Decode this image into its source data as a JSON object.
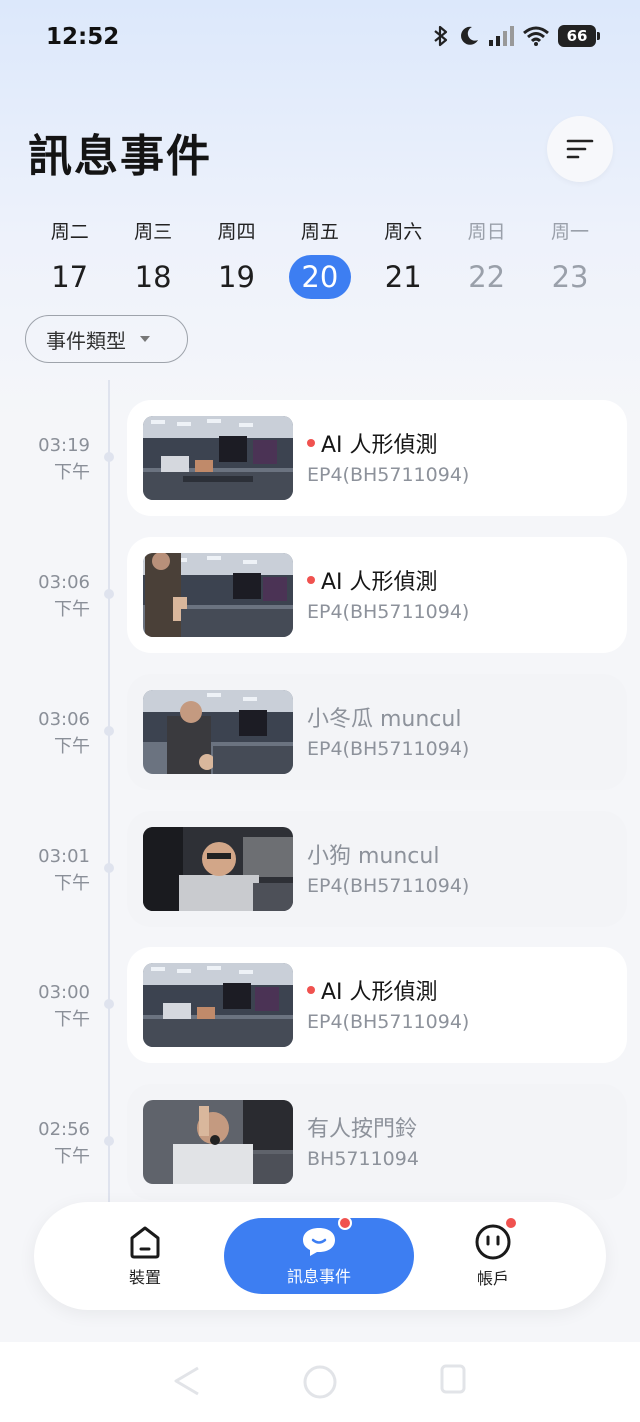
{
  "status_bar": {
    "time": "12:52",
    "battery": "66"
  },
  "header": {
    "title": "訊息事件"
  },
  "week": [
    {
      "name": "周二",
      "num": "17"
    },
    {
      "name": "周三",
      "num": "18"
    },
    {
      "name": "周四",
      "num": "19"
    },
    {
      "name": "周五",
      "num": "20",
      "selected": true
    },
    {
      "name": "周六",
      "num": "21"
    },
    {
      "name": "周日",
      "num": "22",
      "future": true
    },
    {
      "name": "周一",
      "num": "23",
      "future": true
    }
  ],
  "filter": {
    "label": "事件類型"
  },
  "events": [
    {
      "time": "03:19",
      "period": "下午",
      "title": "AI 人形偵測",
      "device": "EP4(BH5711094)",
      "unread": true
    },
    {
      "time": "03:06",
      "period": "下午",
      "title": "AI 人形偵測",
      "device": "EP4(BH5711094)",
      "unread": true
    },
    {
      "time": "03:06",
      "period": "下午",
      "title": "小冬瓜 muncul",
      "device": "EP4(BH5711094)",
      "unread": false
    },
    {
      "time": "03:01",
      "period": "下午",
      "title": "小狗 muncul",
      "device": "EP4(BH5711094)",
      "unread": false
    },
    {
      "time": "03:00",
      "period": "下午",
      "title": "AI 人形偵測",
      "device": "EP4(BH5711094)",
      "unread": true
    },
    {
      "time": "02:56",
      "period": "下午",
      "title": "有人按門鈴",
      "device": "BH5711094",
      "unread": false
    }
  ],
  "bottom_nav": {
    "devices": "裝置",
    "events": "訊息事件",
    "account": "帳戶"
  },
  "colors": {
    "accent": "#3d7ef2",
    "badge": "#f0524f"
  }
}
